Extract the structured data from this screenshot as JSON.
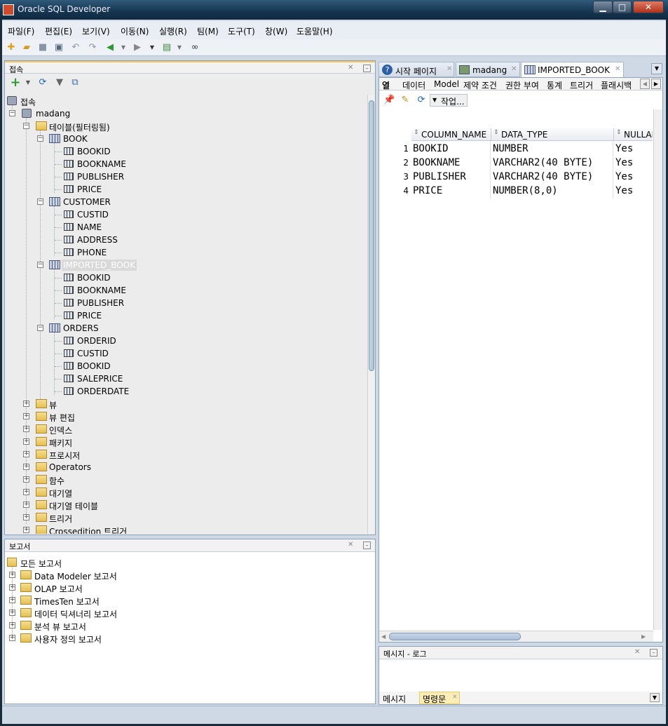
{
  "window": {
    "title": "Oracle SQL Developer"
  },
  "menu": [
    "파일(F)",
    "편집(E)",
    "보기(V)",
    "이동(N)",
    "실행(R)",
    "팀(M)",
    "도구(T)",
    "창(W)",
    "도움말(H)"
  ],
  "connections_panel": {
    "title": "접속",
    "root": "접속",
    "connection": "madang",
    "tables_folder": "테이블(필터링됨)",
    "tables": [
      {
        "name": "BOOK",
        "columns": [
          "BOOKID",
          "BOOKNAME",
          "PUBLISHER",
          "PRICE"
        ]
      },
      {
        "name": "CUSTOMER",
        "columns": [
          "CUSTID",
          "NAME",
          "ADDRESS",
          "PHONE"
        ]
      },
      {
        "name": "IMPORTED_BOOK",
        "columns": [
          "BOOKID",
          "BOOKNAME",
          "PUBLISHER",
          "PRICE"
        ]
      },
      {
        "name": "ORDERS",
        "columns": [
          "ORDERID",
          "CUSTID",
          "BOOKID",
          "SALEPRICE",
          "ORDERDATE"
        ]
      }
    ],
    "other_folders": [
      "뷰",
      "뷰 편집",
      "인덱스",
      "패키지",
      "프로시저",
      "Operators",
      "함수",
      "대기열",
      "대기열 테이블",
      "트리거",
      "Crossedition 트리거"
    ]
  },
  "reports_panel": {
    "title": "보고서",
    "root": "모든 보고서",
    "folders": [
      "Data Modeler 보고서",
      "OLAP 보고서",
      "TimesTen 보고서",
      "데이터 딕셔너리 보고서",
      "분석 뷰 보고서",
      "사용자 정의 보고서"
    ]
  },
  "editor_tabs": [
    "시작 페이지",
    "madang",
    "IMPORTED_BOOK"
  ],
  "object_subtabs": [
    "열",
    "데이터",
    "Model",
    "제약 조건",
    "권한 부여",
    "통계",
    "트리거",
    "플래시백"
  ],
  "actions_label": "작업...",
  "columns_grid": {
    "headers": [
      "COLUMN_NAME",
      "DATA_TYPE",
      "NULLABLE"
    ],
    "rows": [
      [
        "1",
        "BOOKID",
        "NUMBER",
        "Yes"
      ],
      [
        "2",
        "BOOKNAME",
        "VARCHAR2(40 BYTE)",
        "Yes"
      ],
      [
        "3",
        "PUBLISHER",
        "VARCHAR2(40 BYTE)",
        "Yes"
      ],
      [
        "4",
        "PRICE",
        "NUMBER(8,0)",
        "Yes"
      ]
    ]
  },
  "log_panel": {
    "title": "메시지 - 로그",
    "tabs": [
      "메시지",
      "명령문"
    ]
  }
}
